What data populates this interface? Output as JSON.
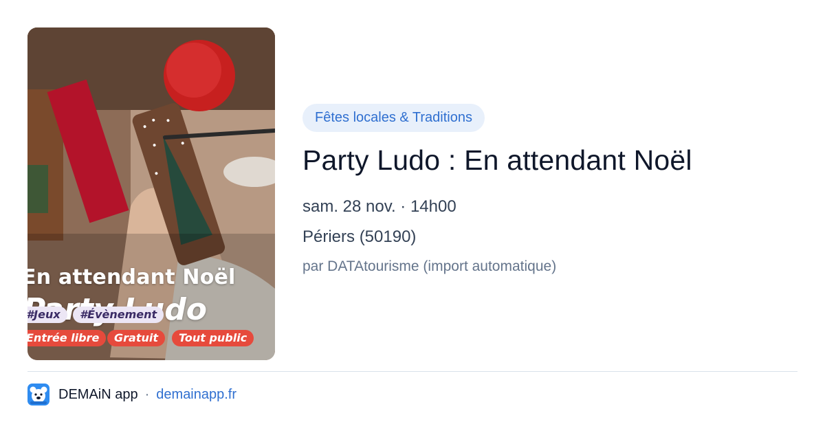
{
  "image": {
    "title_line1": "En attendant Noël",
    "title_line2": "Party Ludo",
    "hashtags": [
      "#Jeux",
      "#Évènement"
    ],
    "badges": [
      "Entrée libre",
      "Gratuit",
      "Tout public"
    ]
  },
  "event": {
    "category": "Fêtes locales & Traditions",
    "title": "Party Ludo : En attendant Noël",
    "date": "sam. 28 nov. · 14h00",
    "location": "Périers (50190)",
    "source": "par DATAtourisme (import automatique)"
  },
  "footer": {
    "app_name": "DEMAiN app",
    "separator": "·",
    "domain": "demainapp.fr",
    "logo_icon": "bear-face-icon"
  },
  "colors": {
    "accent": "#2f6fd0",
    "chip_bg": "#e8f0fb",
    "badge_red": "#e64a3c",
    "hashtag_bg": "#ece6f5"
  }
}
